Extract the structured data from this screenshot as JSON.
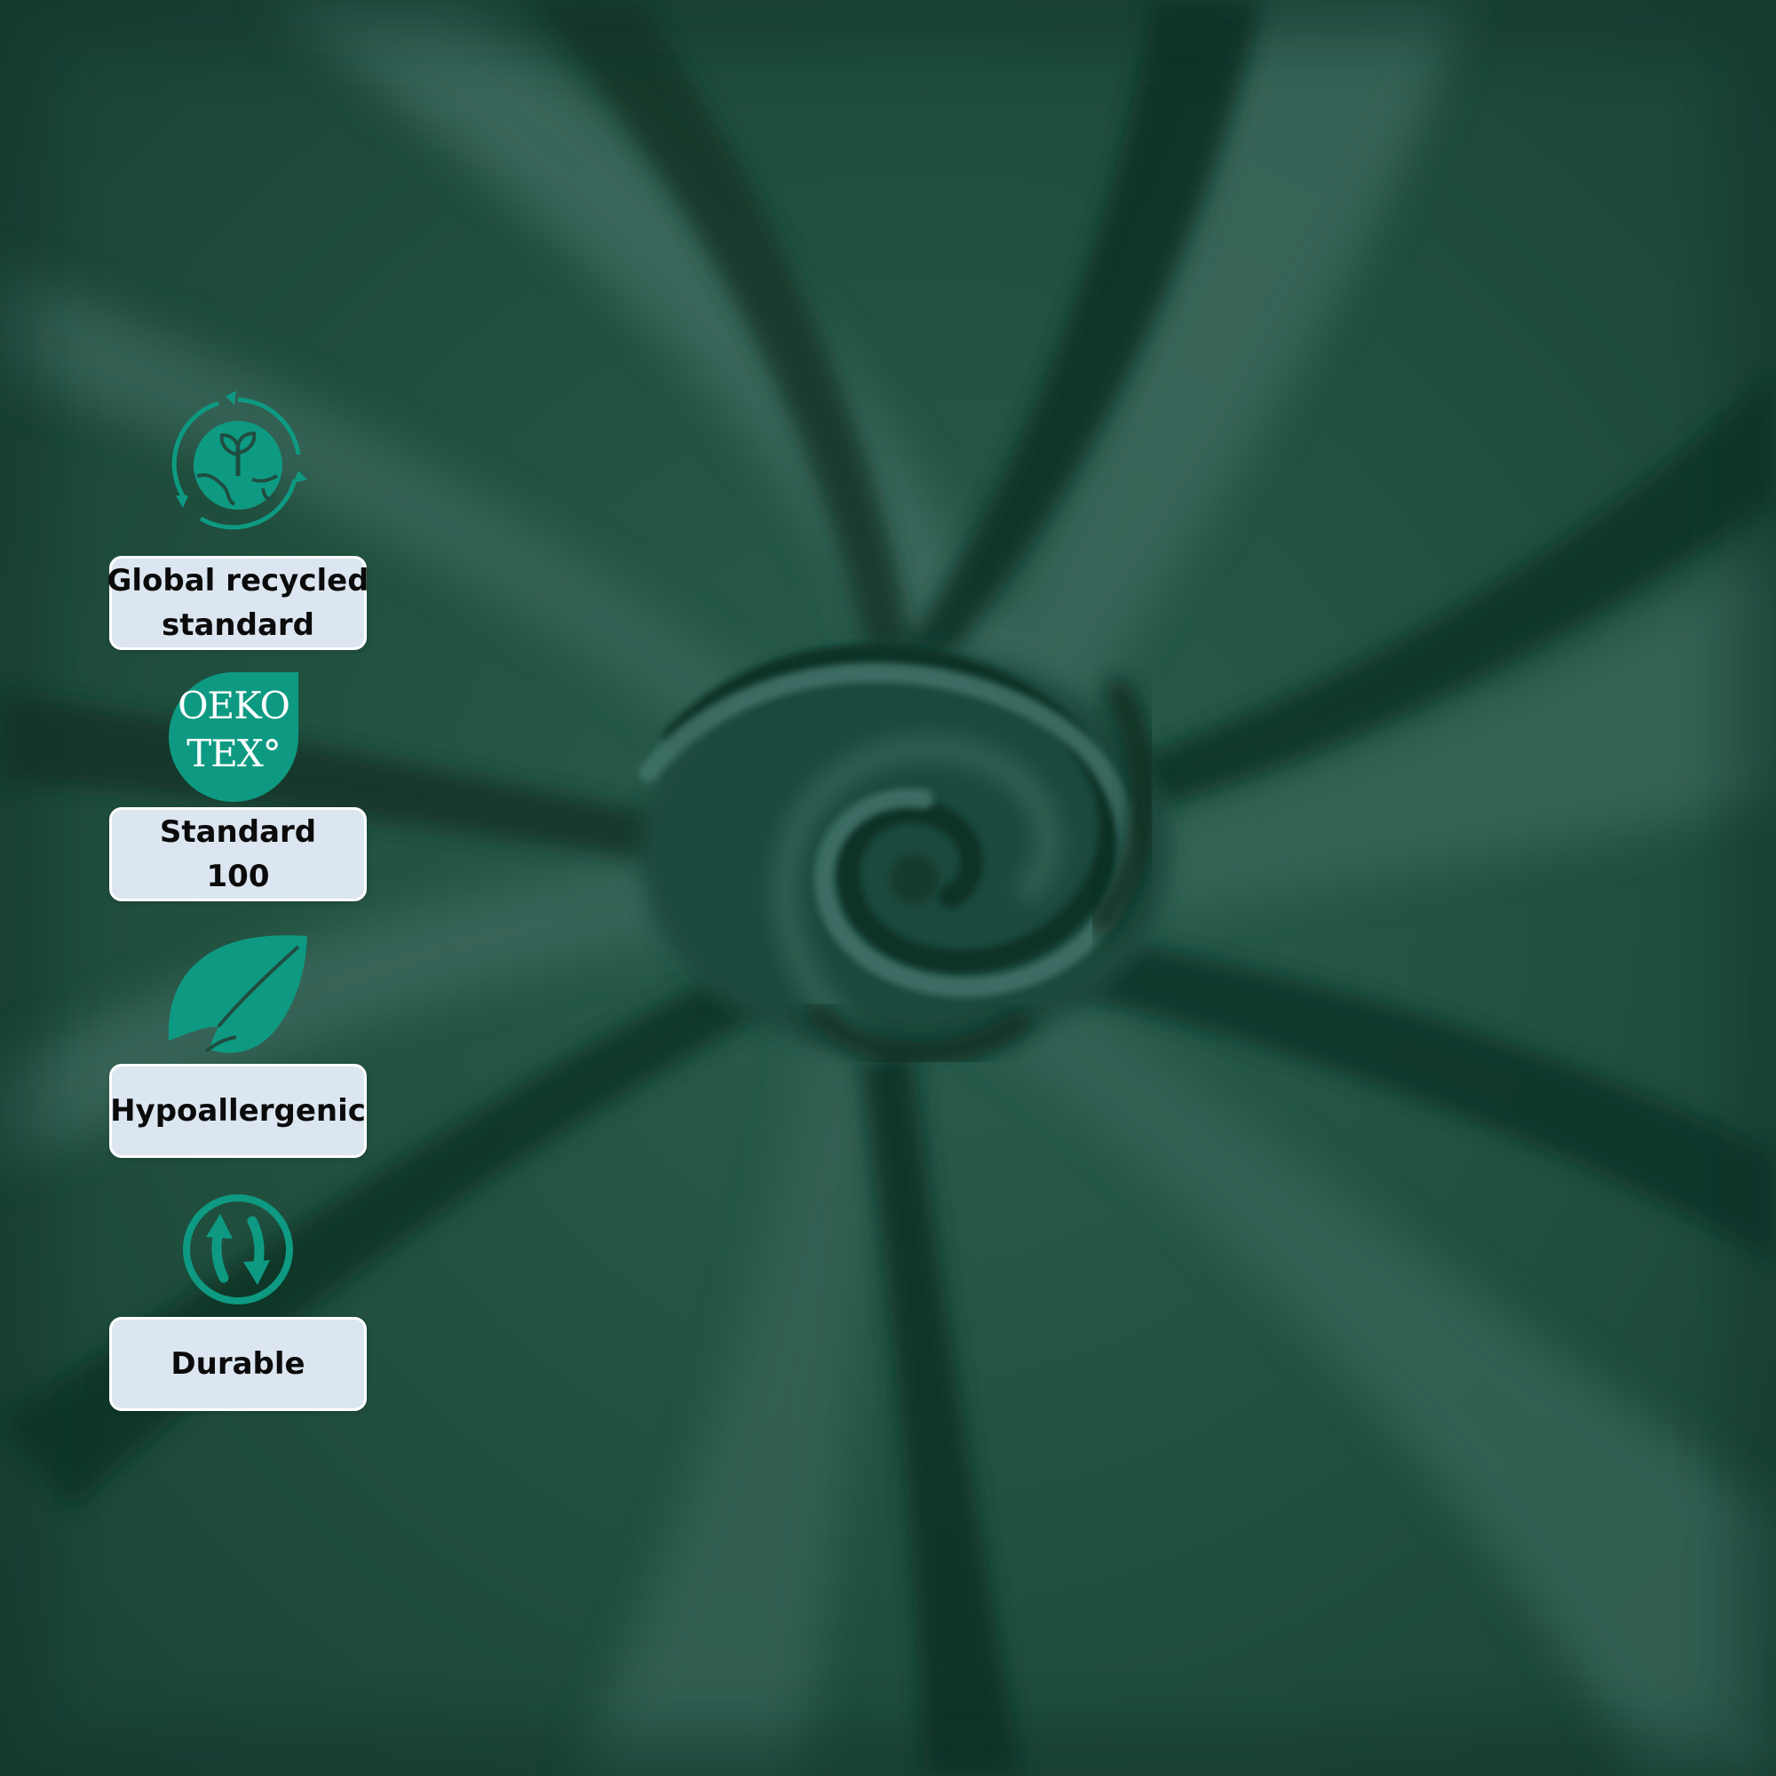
{
  "colors": {
    "fabric_base": "#1f4d41",
    "fabric_highlight": "#3f6d60",
    "fabric_shadow": "#0f3227",
    "icon_teal": "#0e9a82",
    "badge_bg": "#dce6f1",
    "badge_border": "#ffffff",
    "badge_text": "#0b0b0b"
  },
  "features": [
    {
      "icon": "recycle-globe-icon",
      "label_lines": [
        "Global recycled",
        "standard"
      ]
    },
    {
      "icon": "oeko-tex-logo",
      "logo_text": [
        "OEKO",
        "TEX°"
      ],
      "label_lines": [
        "Standard",
        "100"
      ]
    },
    {
      "icon": "leaf-icon",
      "label_lines": [
        "Hypoallergenic"
      ]
    },
    {
      "icon": "durable-arrows-icon",
      "label_lines": [
        "Durable"
      ]
    }
  ]
}
